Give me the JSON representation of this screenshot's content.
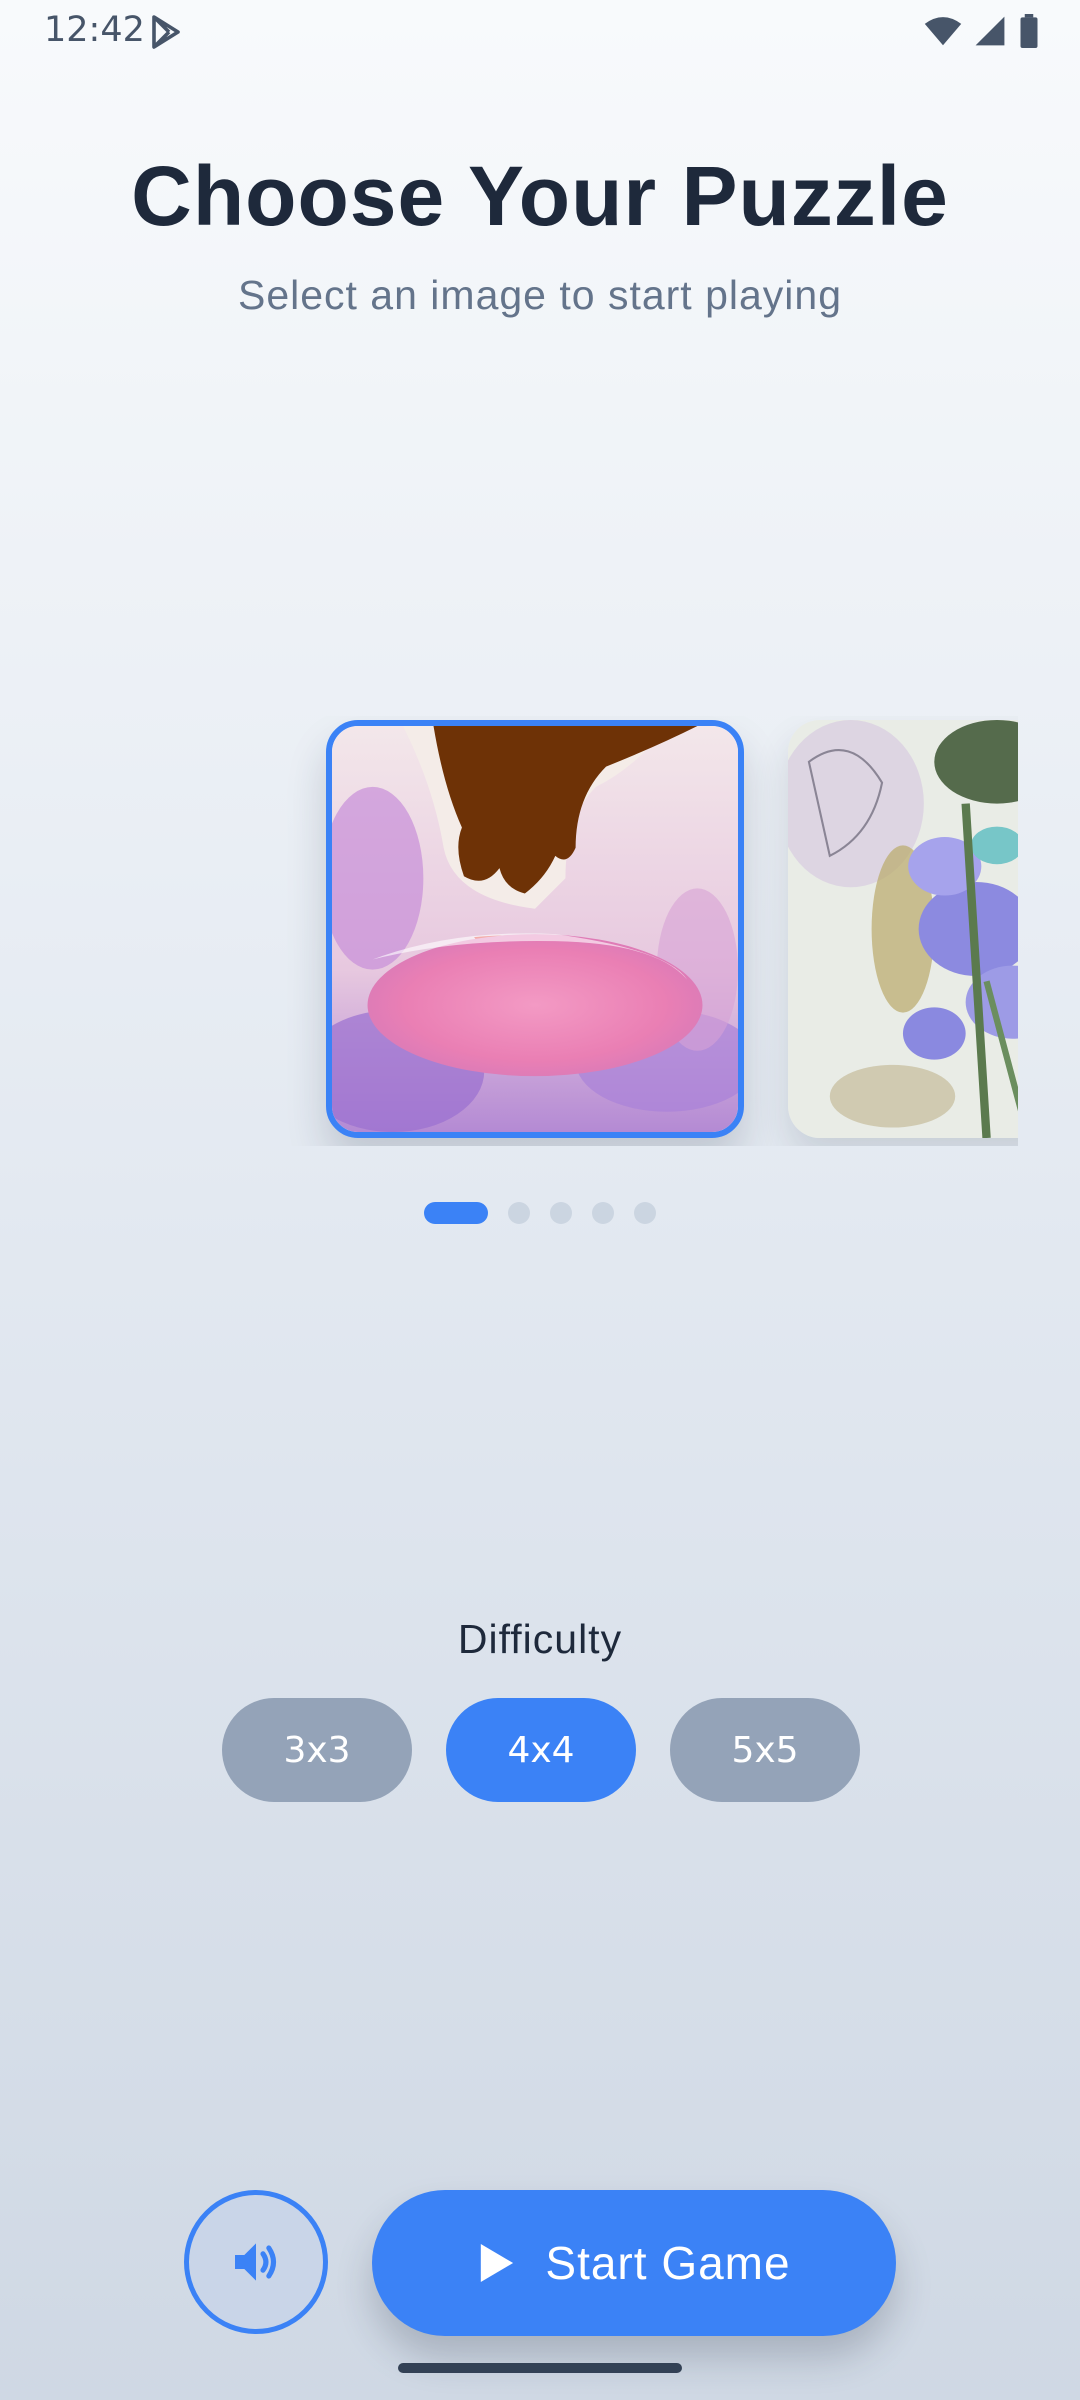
{
  "status_bar": {
    "time": "12:42",
    "icons": [
      "play-store-icon",
      "wifi-icon",
      "signal-icon",
      "battery-icon"
    ]
  },
  "header": {
    "title": "Choose Your Puzzle",
    "subtitle": "Select an image to start playing"
  },
  "carousel": {
    "images": [
      {
        "name": "abstract-pink-artwork",
        "selected": true
      },
      {
        "name": "blue-flowers-artwork",
        "selected": false
      }
    ],
    "page_count": 5,
    "active_page": 1
  },
  "difficulty": {
    "label": "Difficulty",
    "options": [
      "3x3",
      "4x4",
      "5x5"
    ],
    "selected": "4x4"
  },
  "controls": {
    "sound_icon": "volume-icon",
    "start_label": "Start Game",
    "start_icon": "play-icon"
  },
  "colors": {
    "accent": "#3b82f6",
    "inactive_button": "#94a3b8",
    "title": "#1e293b",
    "subtitle": "#64748b"
  }
}
